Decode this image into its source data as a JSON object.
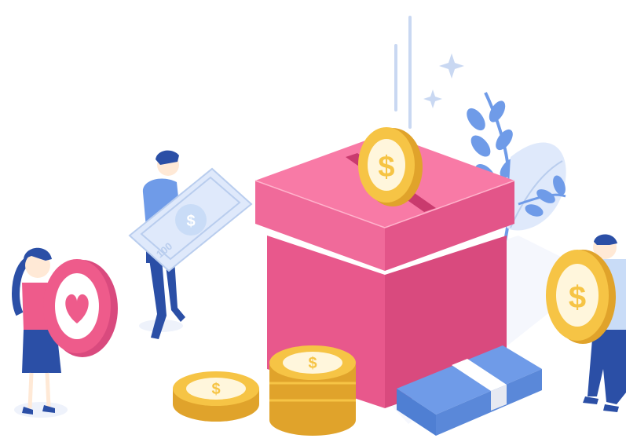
{
  "illustration": {
    "colors": {
      "box_top": "#f87aa6",
      "box_front": "#e8588c",
      "box_side": "#d94a7e",
      "coin_gold": "#f6c445",
      "coin_dark": "#e0a32b",
      "coin_light": "#fff6dc",
      "bill_blue": "#6f9be8",
      "bill_light": "#dfe9fb",
      "leaf_blue": "#6f9be8",
      "leaf_light": "#c9dcf7",
      "pink_coin": "#ee5b8b",
      "skin": "#ffffff"
    },
    "icons": [
      "dollar-coin-icon",
      "heart-coin-icon",
      "banknote-icon",
      "sparkle-icon",
      "leaf-icon",
      "donation-box-icon"
    ],
    "bill_label": "100",
    "coin_symbol": "$"
  }
}
